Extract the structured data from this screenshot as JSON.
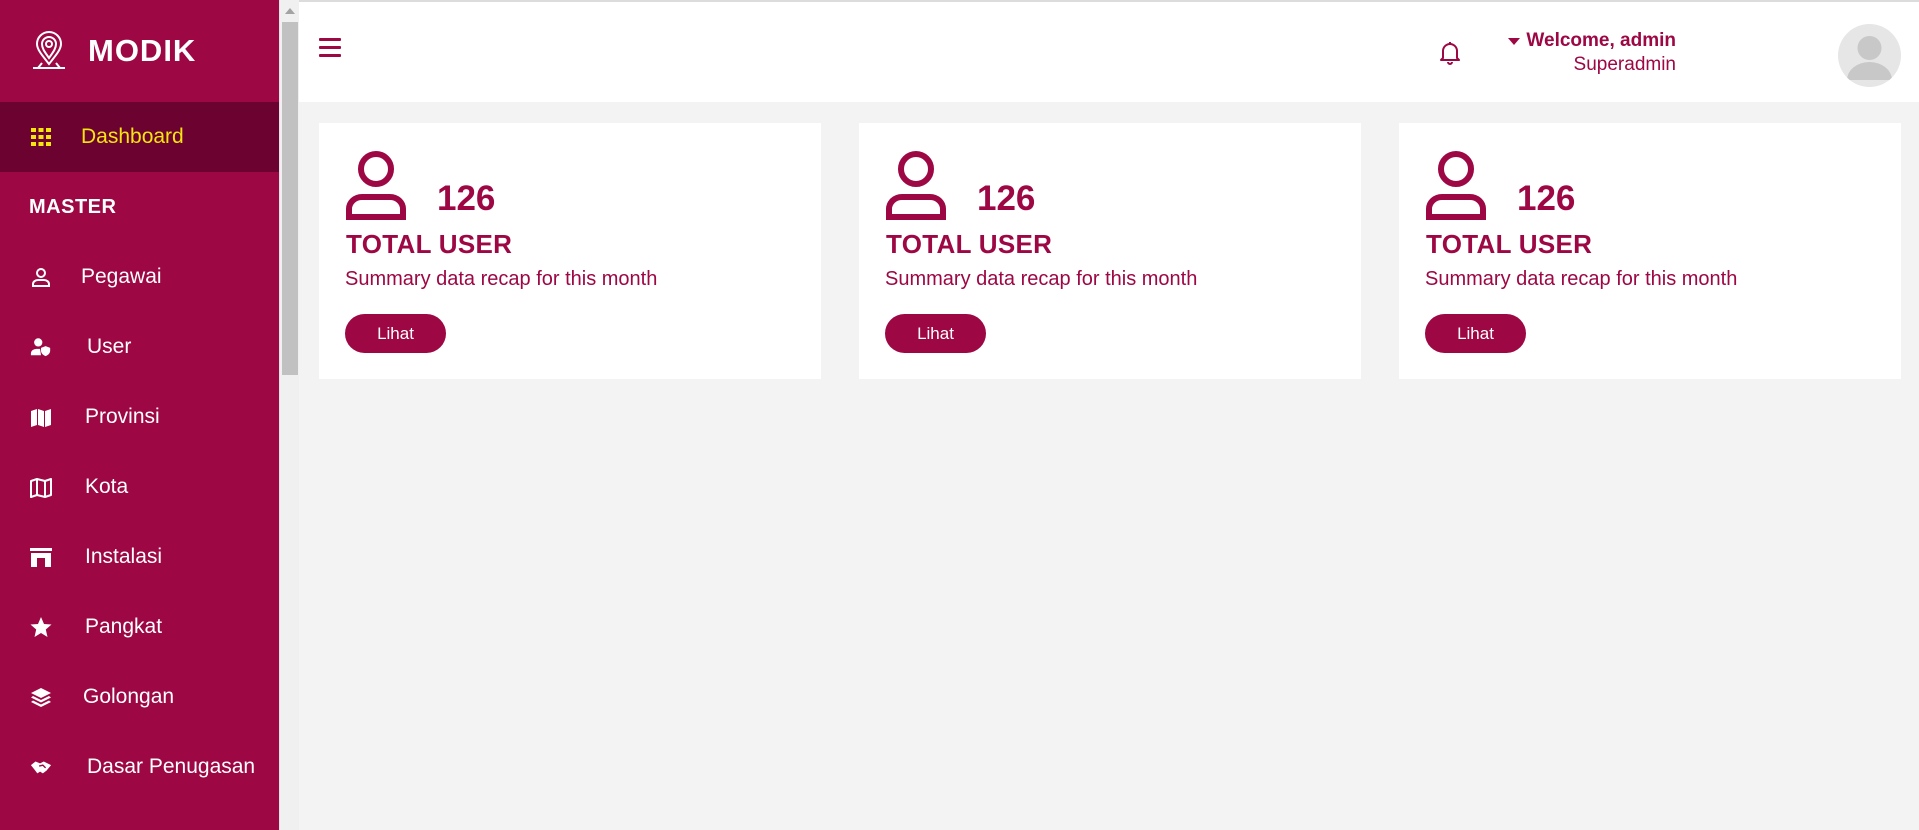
{
  "app": {
    "name": "MODIK"
  },
  "sidebar": {
    "items": [
      {
        "label": "Dashboard",
        "icon": "grid-icon",
        "active": true
      },
      {
        "section": "MASTER"
      },
      {
        "label": "Pegawai",
        "icon": "user-outline-icon"
      },
      {
        "label": "User",
        "icon": "user-shield-icon"
      },
      {
        "label": "Provinsi",
        "icon": "map-solid-icon"
      },
      {
        "label": "Kota",
        "icon": "map-outline-icon"
      },
      {
        "label": "Instalasi",
        "icon": "building-icon"
      },
      {
        "label": "Pangkat",
        "icon": "star-icon"
      },
      {
        "label": "Golongan",
        "icon": "layers-icon"
      },
      {
        "label": "Dasar Penugasan",
        "icon": "handshake-icon"
      }
    ]
  },
  "header": {
    "welcome": "Welcome, admin",
    "role": "Superadmin"
  },
  "cards": [
    {
      "count": "126",
      "title": "TOTAL USER",
      "desc": "Summary data recap for this month",
      "button": "Lihat"
    },
    {
      "count": "126",
      "title": "TOTAL USER",
      "desc": "Summary data recap for this month",
      "button": "Lihat"
    },
    {
      "count": "126",
      "title": "TOTAL USER",
      "desc": "Summary data recap for this month",
      "button": "Lihat"
    }
  ],
  "colors": {
    "primary": "#9c0744",
    "sidebar_active": "#6c0230",
    "active_text": "#f4e410",
    "background": "#f3f3f3"
  }
}
